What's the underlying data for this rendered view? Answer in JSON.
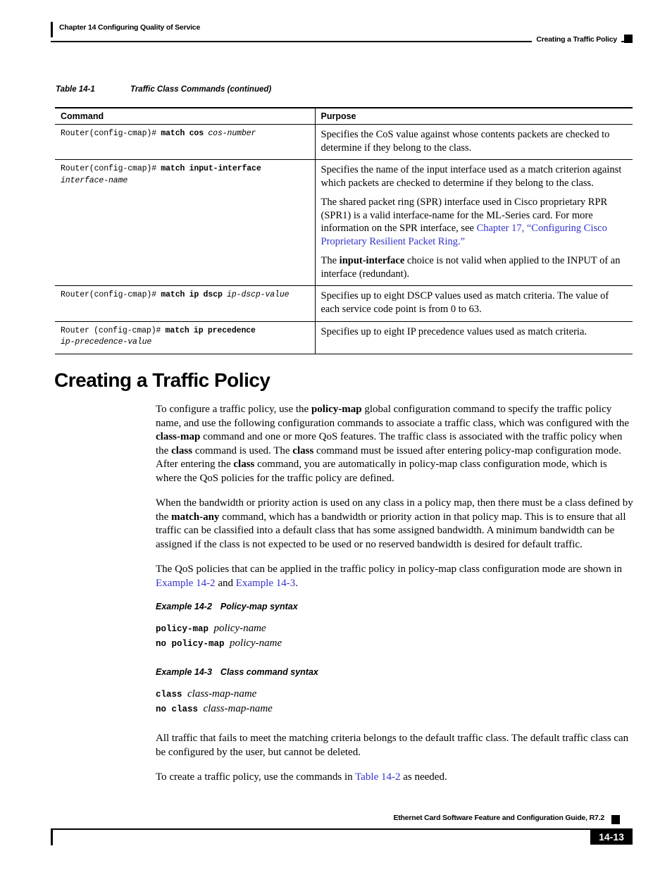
{
  "header": {
    "chapter": "Chapter 14      Configuring Quality of Service",
    "section": "Creating a Traffic Policy"
  },
  "table": {
    "caption_number": "Table 14-1",
    "caption_title": "Traffic Class Commands (continued)",
    "columns": [
      "Command",
      "Purpose"
    ],
    "rows": [
      {
        "command": {
          "prompt": "Router(config-cmap)# ",
          "bold": "match cos ",
          "italic": "cos-number"
        },
        "purpose": [
          "Specifies the CoS value against whose contents packets are checked to determine if they belong to the class."
        ]
      },
      {
        "command": {
          "prompt": "Router(config-cmap)# ",
          "bold": "match input-interface",
          "italic": "interface-name"
        },
        "purpose": [
          "Specifies the name of the input interface used as a match criterion against which packets are checked to determine if they belong to the class.",
          "The shared packet ring (SPR) interface used in Cisco proprietary RPR  (SPR1) is a valid interface-name for the ML-Series card. For more information on the SPR interface, see ",
          "The input-interface choice is not valid when applied to the INPUT of an interface (redundant)."
        ],
        "purpose_link": "Chapter 17, “Configuring Cisco Proprietary Resilient Packet Ring.”",
        "purpose_p3_pre": "The ",
        "purpose_p3_bold": "input-interface",
        "purpose_p3_post": " choice is not valid when applied to the INPUT of an interface (redundant)."
      },
      {
        "command": {
          "prompt": "Router(config-cmap)# ",
          "bold": "match ip dscp ",
          "italic": "ip-dscp-value"
        },
        "purpose": [
          "Specifies up to eight DSCP values used as match criteria. The value of each service code point is from 0 to 63."
        ]
      },
      {
        "command": {
          "prompt": "Router (config-cmap)# ",
          "bold": "match ip precedence",
          "italic": "ip-precedence-value"
        },
        "purpose": [
          "Specifies up to eight IP precedence values used as match criteria."
        ]
      }
    ]
  },
  "section_heading": "Creating a Traffic Policy",
  "paragraphs": {
    "p1_a": "To configure a traffic policy, use the ",
    "p1_b1": "policy-map",
    "p1_b": " global configuration command to specify the traffic policy name, and use the following configuration commands to associate a traffic class, which was configured with the ",
    "p1_b2": "class-map",
    "p1_c": " command and one or more QoS features. The traffic class is associated with the traffic policy when the ",
    "p1_b3": "class",
    "p1_d": " command is used. The ",
    "p1_b4": "class",
    "p1_e": " command must be issued after entering policy-map configuration mode. After entering the ",
    "p1_b5": "class",
    "p1_f": " command, you are automatically in policy-map class configuration mode, which is where the QoS policies for the traffic policy are defined.",
    "p2_a": "When the bandwidth or priority action is used on any class in a policy map, then there must be a class defined by the ",
    "p2_b1": "match-any",
    "p2_b": " command, which has a bandwidth or priority action in that policy map. This is to ensure that all traffic can be classified into a default class that has some assigned bandwidth. A minimum bandwidth can be assigned if the class is not expected to be used or no reserved bandwidth is desired for default traffic.",
    "p3_a": "The QoS policies that can be applied in the traffic policy in policy-map class configuration mode are shown in ",
    "p3_link1": "Example 14-2",
    "p3_mid": " and ",
    "p3_link2": "Example 14-3",
    "p3_end": ".",
    "p4": "All traffic that fails to meet the matching criteria belongs to the default traffic class. The default traffic class can be configured by the user, but cannot be deleted.",
    "p5_a": "To create a traffic policy, use the commands in ",
    "p5_link": "Table 14-2",
    "p5_b": " as needed."
  },
  "examples": [
    {
      "number": "Example 14-2",
      "title": "Policy-map syntax",
      "line1_cmd": "policy-map ",
      "line1_var": "policy-name",
      "line2_cmd": "no policy-map ",
      "line2_var": "policy-name"
    },
    {
      "number": "Example 14-3",
      "title": "Class command syntax",
      "line1_cmd": "class ",
      "line1_var": "class-map-name",
      "line2_cmd": "no class ",
      "line2_var": "class-map-name"
    }
  ],
  "footer": {
    "guide": "Ethernet Card Software Feature and Configuration Guide, R7.2",
    "page": "14-13"
  },
  "colors": {
    "link": "#3333cc",
    "text": "#000000"
  }
}
